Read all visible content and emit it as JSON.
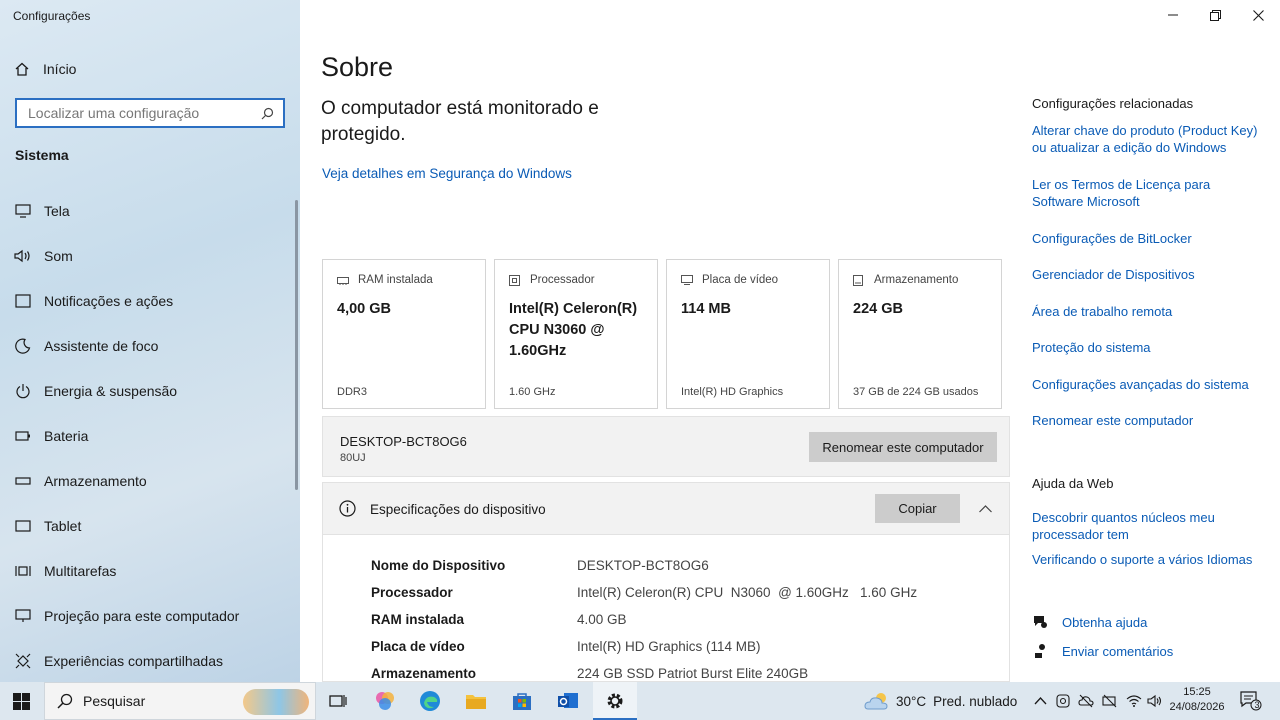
{
  "app_title": "Configurações",
  "sidebar": {
    "home_label": "Início",
    "search_placeholder": "Localizar uma configuração",
    "section_label": "Sistema",
    "items": [
      {
        "label": "Tela",
        "icon": "monitor-icon"
      },
      {
        "label": "Som",
        "icon": "speaker-icon"
      },
      {
        "label": "Notificações e ações",
        "icon": "notification-icon"
      },
      {
        "label": "Assistente de foco",
        "icon": "moon-icon"
      },
      {
        "label": "Energia & suspensão",
        "icon": "power-icon"
      },
      {
        "label": "Bateria",
        "icon": "battery-icon"
      },
      {
        "label": "Armazenamento",
        "icon": "storage-icon"
      },
      {
        "label": "Tablet",
        "icon": "tablet-icon"
      },
      {
        "label": "Multitarefas",
        "icon": "multitask-icon"
      },
      {
        "label": "Projeção para este computador",
        "icon": "projection-icon"
      },
      {
        "label": "Experiências compartilhadas",
        "icon": "shared-icon"
      }
    ]
  },
  "main": {
    "title": "Sobre",
    "status": "O computador está monitorado e protegido.",
    "security_link": "Veja detalhes em Segurança do Windows",
    "cards": [
      {
        "label": "RAM instalada",
        "value": "4,00 GB",
        "sub": "DDR3",
        "icon": "ram-icon"
      },
      {
        "label": "Processador",
        "value": "Intel(R) Celeron(R) CPU  N3060  @ 1.60GHz",
        "sub": "1.60 GHz",
        "icon": "cpu-icon"
      },
      {
        "label": "Placa de vídeo",
        "value": "114 MB",
        "sub": "Intel(R) HD Graphics",
        "icon": "gpu-icon"
      },
      {
        "label": "Armazenamento",
        "value": "224 GB",
        "sub": "37 GB de 224 GB usados",
        "icon": "disk-icon"
      }
    ],
    "device_name": "DESKTOP-BCT8OG6",
    "device_model": "80UJ",
    "rename_button": "Renomear este computador",
    "specs_title": "Especificações do dispositivo",
    "copy_button": "Copiar",
    "specs": [
      {
        "key": "Nome do Dispositivo",
        "value": "DESKTOP-BCT8OG6"
      },
      {
        "key": "Processador",
        "value": "Intel(R) Celeron(R) CPU  N3060  @ 1.60GHz   1.60 GHz"
      },
      {
        "key": "RAM instalada",
        "value": "4.00 GB"
      },
      {
        "key": "Placa de vídeo",
        "value": "Intel(R) HD Graphics (114 MB)"
      },
      {
        "key": "Armazenamento",
        "value": "224 GB SSD Patriot Burst Elite 240GB"
      }
    ]
  },
  "related": {
    "title": "Configurações relacionadas",
    "links": [
      "Alterar chave do produto (Product Key) ou atualizar a edição do Windows",
      "Ler os Termos de Licença para Software Microsoft",
      "Configurações de BitLocker",
      "Gerenciador de Dispositivos",
      "Área de trabalho remota",
      "Proteção do sistema",
      "Configurações avançadas do sistema",
      "Renomear este computador"
    ],
    "web_help_title": "Ajuda da Web",
    "web_links": [
      "Descobrir quantos núcleos meu processador tem",
      "Verificando o suporte a vários Idiomas"
    ],
    "get_help": "Obtenha ajuda",
    "feedback": "Enviar comentários"
  },
  "taskbar": {
    "search_label": "Pesquisar",
    "weather_temp": "30°C",
    "weather_desc": "Pred. nublado",
    "time": "15:25",
    "date": "24/08/2026",
    "notification_count": "3"
  }
}
